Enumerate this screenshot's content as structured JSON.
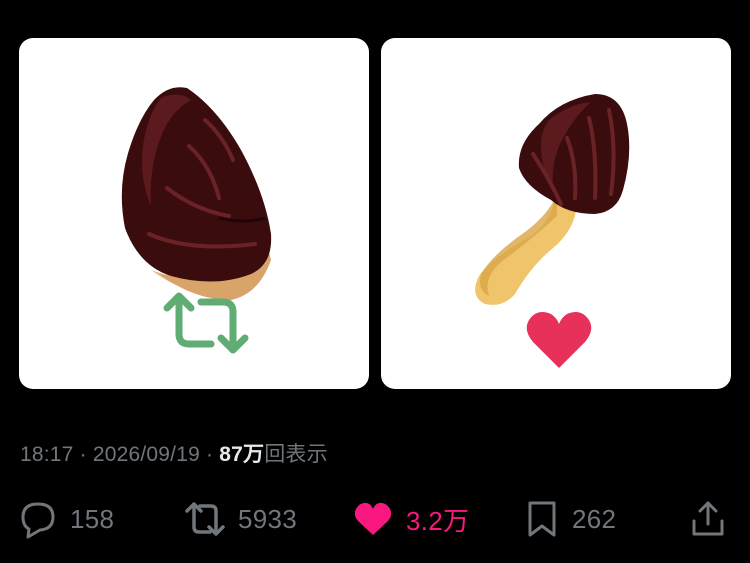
{
  "tweet": {
    "images": [
      {
        "name": "bamboo-shoot-chocolate-with-retweet",
        "icon": "retweet-icon",
        "icon_color": "#5fac74"
      },
      {
        "name": "mushroom-chocolate-with-like",
        "icon": "heart-icon",
        "icon_color": "#e8315a"
      }
    ],
    "meta": {
      "time": "18:17",
      "separator": "·",
      "date": "2026/09/19",
      "views_number": "87万",
      "views_label": "回表示"
    },
    "actions": {
      "reply": {
        "icon": "reply-icon",
        "count": "158"
      },
      "retweet": {
        "icon": "retweet-icon",
        "count": "5933"
      },
      "like": {
        "icon": "heart-icon",
        "count": "3.2万",
        "color": "#f91880"
      },
      "bookmark": {
        "icon": "bookmark-icon",
        "count": "262"
      },
      "share": {
        "icon": "share-icon"
      }
    }
  }
}
